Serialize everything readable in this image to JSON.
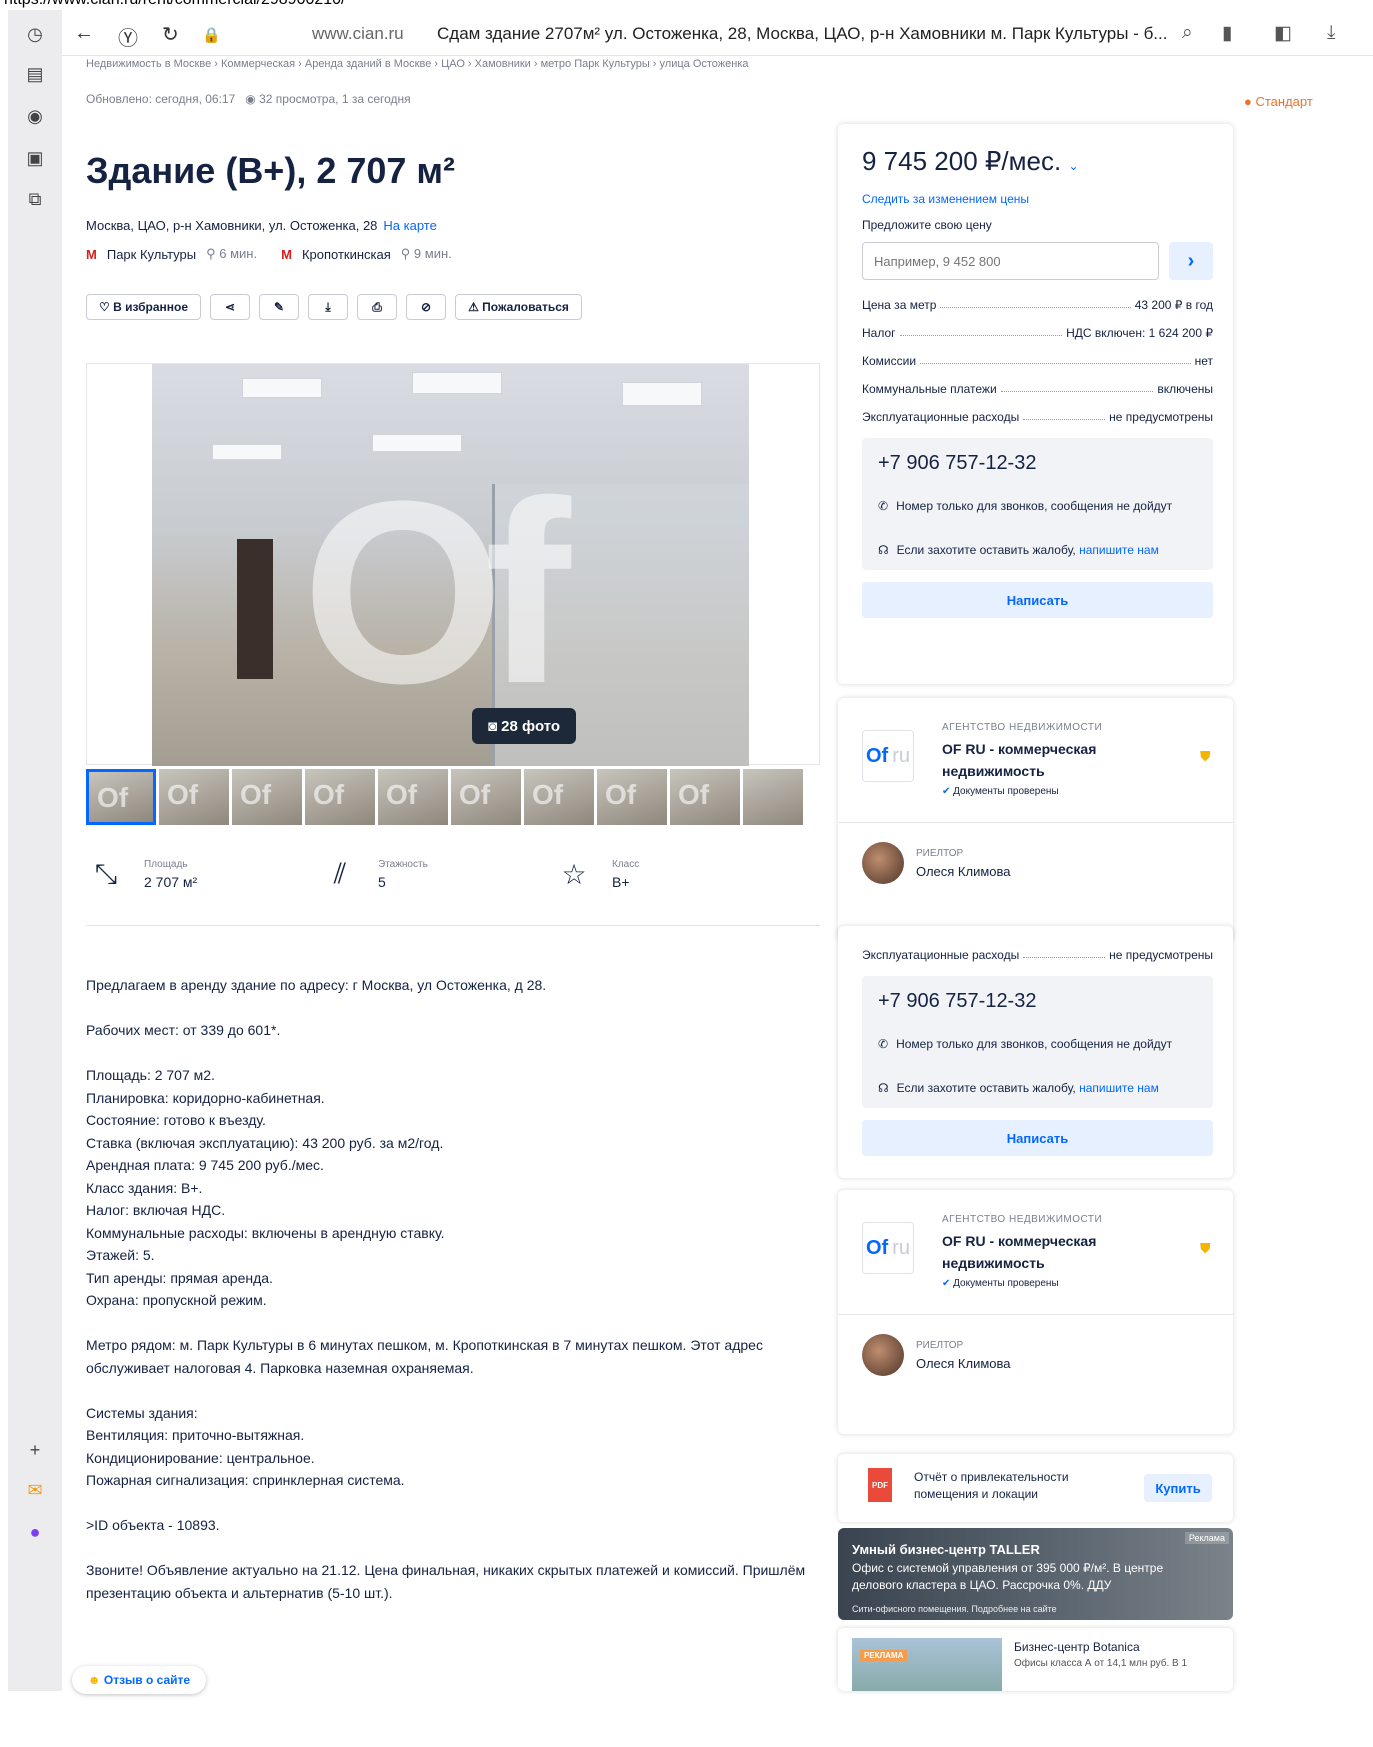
{
  "browser": {
    "url_strip": "https://www.cian.ru/rent/commercial/298900210/",
    "domain": "www.cian.ru",
    "title": "Сдам здание 2707м² ул. Остоженка, 28, Москва, ЦАО, р-н Хамовники м. Парк Культуры - б..."
  },
  "breadcrumbs": "Недвижимость в Москве  ›  Коммерческая  ›  Аренда зданий в Москве  ›  ЦАО  ›  Хамовники  ›  метро Парк Культуры  ›  улица Остоженка",
  "updated": "Обновлено: сегодня, 06:17",
  "views": "32 просмотра, 1 за сегодня",
  "badge": "Стандарт",
  "title": "Здание (В+), 2 707 м²",
  "address": "Москва, ЦАО, р-н Хамовники, ул. Остоженка, 28",
  "map_link": "На карте",
  "metro": [
    {
      "name": "Парк Культуры",
      "time": "6 мин."
    },
    {
      "name": "Кропоткинская",
      "time": "9 мин."
    }
  ],
  "actions": {
    "favorite": "В избранное",
    "complain": "Пожаловаться"
  },
  "photos": {
    "count_label": "28 фото",
    "watermark": "Of"
  },
  "features": [
    {
      "label": "Площадь",
      "value": "2 707 м²"
    },
    {
      "label": "Этажность",
      "value": "5"
    },
    {
      "label": "Класс",
      "value": "B+"
    }
  ],
  "description": [
    "Предлагаем в аренду здание по адресу: г Москва, ул Остоженка, д 28.",
    "Рабочих мест: от 339 до 601*.",
    "Площадь: 2 707 м2.\nПланировка: коридорно-кабинетная.\nСостояние: готово к въезду.\nСтавка (включая эксплуатацию): 43 200 руб. за м2/год.\nАрендная плата: 9 745 200 руб./мес.\nКласс здания: В+.\nНалог: включая НДС.\nКоммунальные расходы: включены в арендную ставку.\nЭтажей: 5.\nТип аренды: прямая аренда.\nОхрана: пропускной режим.",
    "Метро рядом: м. Парк Культуры в 6 минутах пешком, м. Кропоткинская в 7 минутах пешком. Этот адрес обслуживает налоговая 4. Парковка наземная охраняемая.",
    "Системы здания:\nВентиляция: приточно-вытяжная.\nКондиционирование: центральное.\nПожарная сигнализация: спринклерная система.",
    ">ID объекта - 10893.",
    "Звоните! Объявление актуально на 21.12. Цена финальная, никаких скрытых платежей и комиссий. Пришлём презентацию объекта и альтернатив (5-10 шт.)."
  ],
  "review_button": "Отзыв о сайте",
  "sidebar": {
    "price": "9 745 200 ₽/мес.",
    "follow": "Следить за изменением цены",
    "offer_label": "Предложите свою цену",
    "offer_placeholder": "Например, 9 452 800",
    "rows": [
      {
        "k": "Цена за метр",
        "v": "43 200 ₽ в год"
      },
      {
        "k": "Налог",
        "v": "НДС включен: 1 624 200 ₽"
      },
      {
        "k": "Комиссии",
        "v": "нет"
      },
      {
        "k": "Коммунальные платежи",
        "v": "включены"
      },
      {
        "k": "Эксплуатационные расходы",
        "v": "не предусмотрены"
      }
    ],
    "phone": "+7 906 757-12-32",
    "phone_note": "Номер только для звонков, сообщения не дойдут",
    "complain_note": "Если захотите оставить жалобу,",
    "complain_link": "напишите нам",
    "write": "Написать",
    "agency_kind": "АГЕНТСТВО НЕДВИЖИМОСТИ",
    "agency_name": "OF RU - коммерческая недвижимость",
    "agency_checked": "Документы проверены",
    "agency_logo": "Of",
    "agency_logo_ru": "ru",
    "realtor_label": "РИЕЛТОР",
    "realtor_name": "Олеся Климова"
  },
  "report": {
    "text": "Отчёт о привлекательности помещения и локации",
    "buy": "Купить",
    "pdf": "PDF"
  },
  "ad": {
    "tag": "Реклама",
    "title": "Умный бизнес-центр TALLER",
    "text": "Офис с системой управления от 395 000 ₽/м². В центре делового кластера в ЦАО. Рассрочка 0%. ДДУ",
    "small": "Сити-офисного помещения. Подробнее на сайте"
  },
  "ad2": {
    "tag": "РЕКЛАМА",
    "title": "Бизнес-центр Botanica",
    "text": "Офисы класса А от 14,1 млн руб. В 1"
  }
}
